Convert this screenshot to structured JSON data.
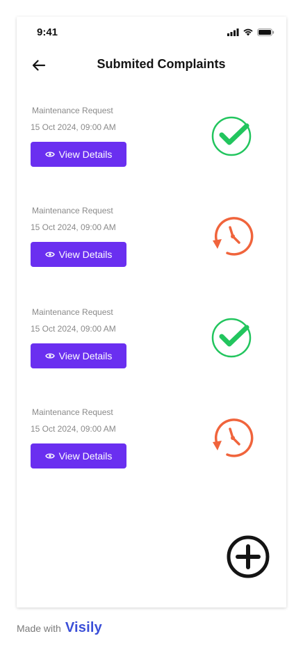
{
  "status_bar": {
    "time": "9:41"
  },
  "header": {
    "title": "Submited Complaints"
  },
  "complaints": [
    {
      "title": "Maintenance Request",
      "date": "15 Oct 2024, 09:00 AM",
      "button_label": "View Details",
      "status": "resolved"
    },
    {
      "title": "Maintenance Request",
      "date": "15 Oct 2024, 09:00 AM",
      "button_label": "View Details",
      "status": "pending"
    },
    {
      "title": "Maintenance Request",
      "date": "15 Oct 2024, 09:00 AM",
      "button_label": "View Details",
      "status": "resolved"
    },
    {
      "title": "Maintenance Request",
      "date": "15 Oct 2024, 09:00 AM",
      "button_label": "View Details",
      "status": "pending"
    }
  ],
  "footer": {
    "made_with": "Made with",
    "brand": "Visily"
  },
  "colors": {
    "accent": "#6a2ff0",
    "resolved": "#22c55e",
    "pending": "#f0643c"
  },
  "icons": {
    "back": "arrow-left-icon",
    "view": "eye-icon",
    "resolved": "check-circle-icon",
    "pending": "clock-history-icon",
    "add": "plus-circle-icon"
  }
}
